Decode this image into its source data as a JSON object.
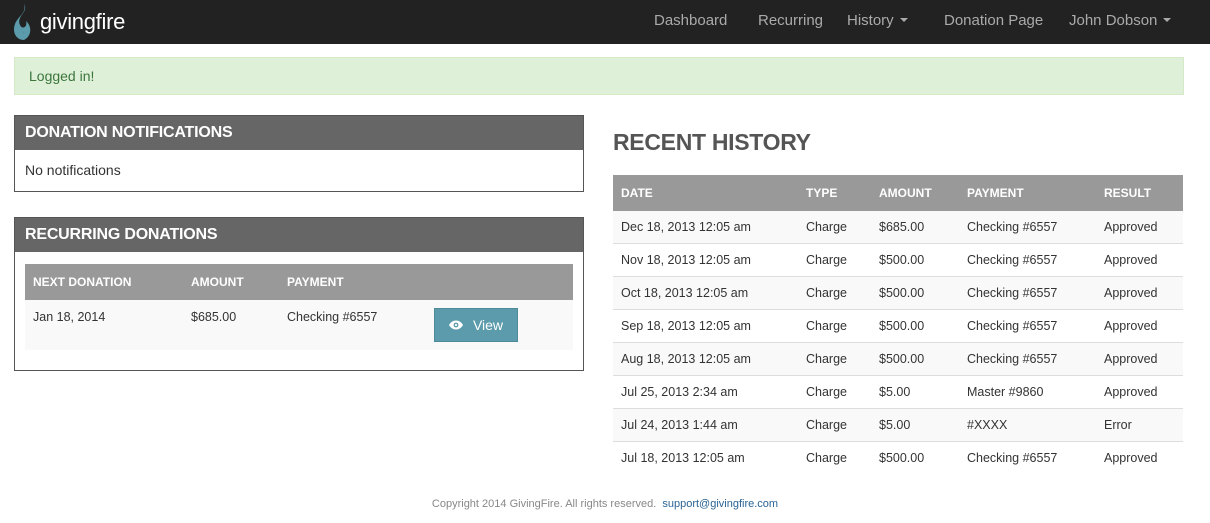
{
  "brand": {
    "name": "givingfire",
    "color": "#5b9bab"
  },
  "nav": {
    "dashboard": "Dashboard",
    "recurring": "Recurring",
    "history": "History",
    "donation_page": "Donation Page",
    "user": "John Dobson"
  },
  "alert": {
    "text": "Logged in!"
  },
  "notifications": {
    "title": "DONATION NOTIFICATIONS",
    "empty_text": "No notifications"
  },
  "recurring": {
    "title": "RECURRING DONATIONS",
    "columns": [
      "NEXT DONATION",
      "AMOUNT",
      "PAYMENT"
    ],
    "rows": [
      {
        "next_donation": "Jan 18, 2014",
        "amount": "$685.00",
        "payment": "Checking #6557",
        "action": "View"
      }
    ]
  },
  "history": {
    "title": "RECENT HISTORY",
    "columns": [
      "DATE",
      "TYPE",
      "AMOUNT",
      "PAYMENT",
      "RESULT"
    ],
    "rows": [
      {
        "date": "Dec 18, 2013 12:05 am",
        "type": "Charge",
        "amount": "$685.00",
        "payment": "Checking #6557",
        "result": "Approved"
      },
      {
        "date": "Nov 18, 2013 12:05 am",
        "type": "Charge",
        "amount": "$500.00",
        "payment": "Checking #6557",
        "result": "Approved"
      },
      {
        "date": "Oct 18, 2013 12:05 am",
        "type": "Charge",
        "amount": "$500.00",
        "payment": "Checking #6557",
        "result": "Approved"
      },
      {
        "date": "Sep 18, 2013 12:05 am",
        "type": "Charge",
        "amount": "$500.00",
        "payment": "Checking #6557",
        "result": "Approved"
      },
      {
        "date": "Aug 18, 2013 12:05 am",
        "type": "Charge",
        "amount": "$500.00",
        "payment": "Checking #6557",
        "result": "Approved"
      },
      {
        "date": "Jul 25, 2013 2:34 am",
        "type": "Charge",
        "amount": "$5.00",
        "payment": "Master #9860",
        "result": "Approved"
      },
      {
        "date": "Jul 24, 2013 1:44 am",
        "type": "Charge",
        "amount": "$5.00",
        "payment": "#XXXX",
        "result": "Error"
      },
      {
        "date": "Jul 18, 2013 12:05 am",
        "type": "Charge",
        "amount": "$500.00",
        "payment": "Checking #6557",
        "result": "Approved"
      }
    ]
  },
  "footer": {
    "copyright": "Copyright 2014 GivingFire. All rights reserved.",
    "email": "support@givingfire.com"
  }
}
